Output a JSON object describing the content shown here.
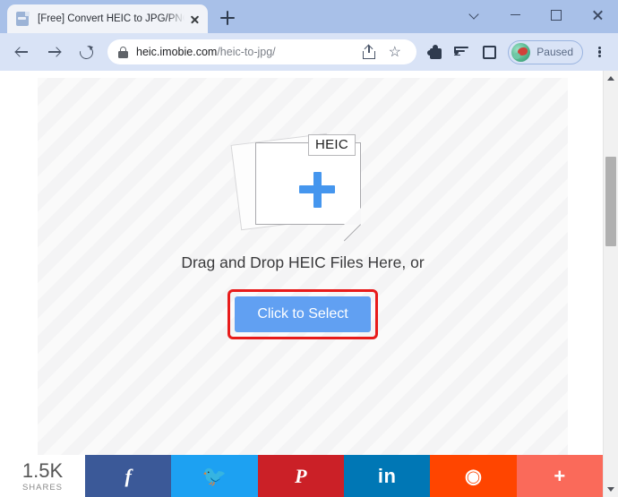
{
  "browser": {
    "tab": {
      "title": "[Free] Convert HEIC to JPG/PNG/",
      "favicon_icon": "document-favicon",
      "close_icon": "close-icon"
    },
    "new_tab_icon": "plus-icon",
    "window_controls": {
      "tab_search_icon": "chevron-down-icon",
      "minimize_icon": "minimize-icon",
      "maximize_icon": "maximize-icon",
      "close_icon": "close-icon"
    },
    "toolbar": {
      "back_icon": "back-arrow-icon",
      "forward_icon": "forward-arrow-icon",
      "reload_icon": "reload-icon",
      "lock_icon": "lock-icon",
      "url_host": "heic.imobie.com",
      "url_path": "/heic-to-jpg/",
      "share_icon": "share-icon",
      "bookmark_icon": "star-icon",
      "extensions_icon": "puzzle-icon",
      "media_list_icon": "media-list-icon",
      "side_panel_icon": "side-panel-icon",
      "profile_label": "Paused",
      "profile_avatar_icon": "avatar-icon",
      "menu_icon": "kebab-menu-icon"
    }
  },
  "page": {
    "dropzone": {
      "file_badge": "HEIC",
      "plus_icon": "plus-icon",
      "instruction": "Drag and Drop HEIC Files Here, or",
      "button_label": "Click to Select"
    },
    "highlight_color": "#e81b1b",
    "button_color": "#61a0f2",
    "share_bar": {
      "count": "1.5K",
      "count_label": "SHARES",
      "buttons": [
        {
          "name": "facebook",
          "glyph": "f",
          "color": "#3b5998"
        },
        {
          "name": "twitter",
          "glyph": "⤵",
          "color": "#1da1f2"
        },
        {
          "name": "pinterest",
          "glyph": "P",
          "color": "#cb2027"
        },
        {
          "name": "linkedin",
          "glyph": "in",
          "color": "#0077b5"
        },
        {
          "name": "reddit",
          "glyph": "◉",
          "color": "#ff4500"
        },
        {
          "name": "more",
          "glyph": "+",
          "color": "#fa6a5a"
        }
      ]
    },
    "scrollbar": {
      "up_arrow_icon": "scroll-up-icon",
      "down_arrow_icon": "scroll-down-icon",
      "thumb_icon": "scrollbar-thumb"
    }
  }
}
